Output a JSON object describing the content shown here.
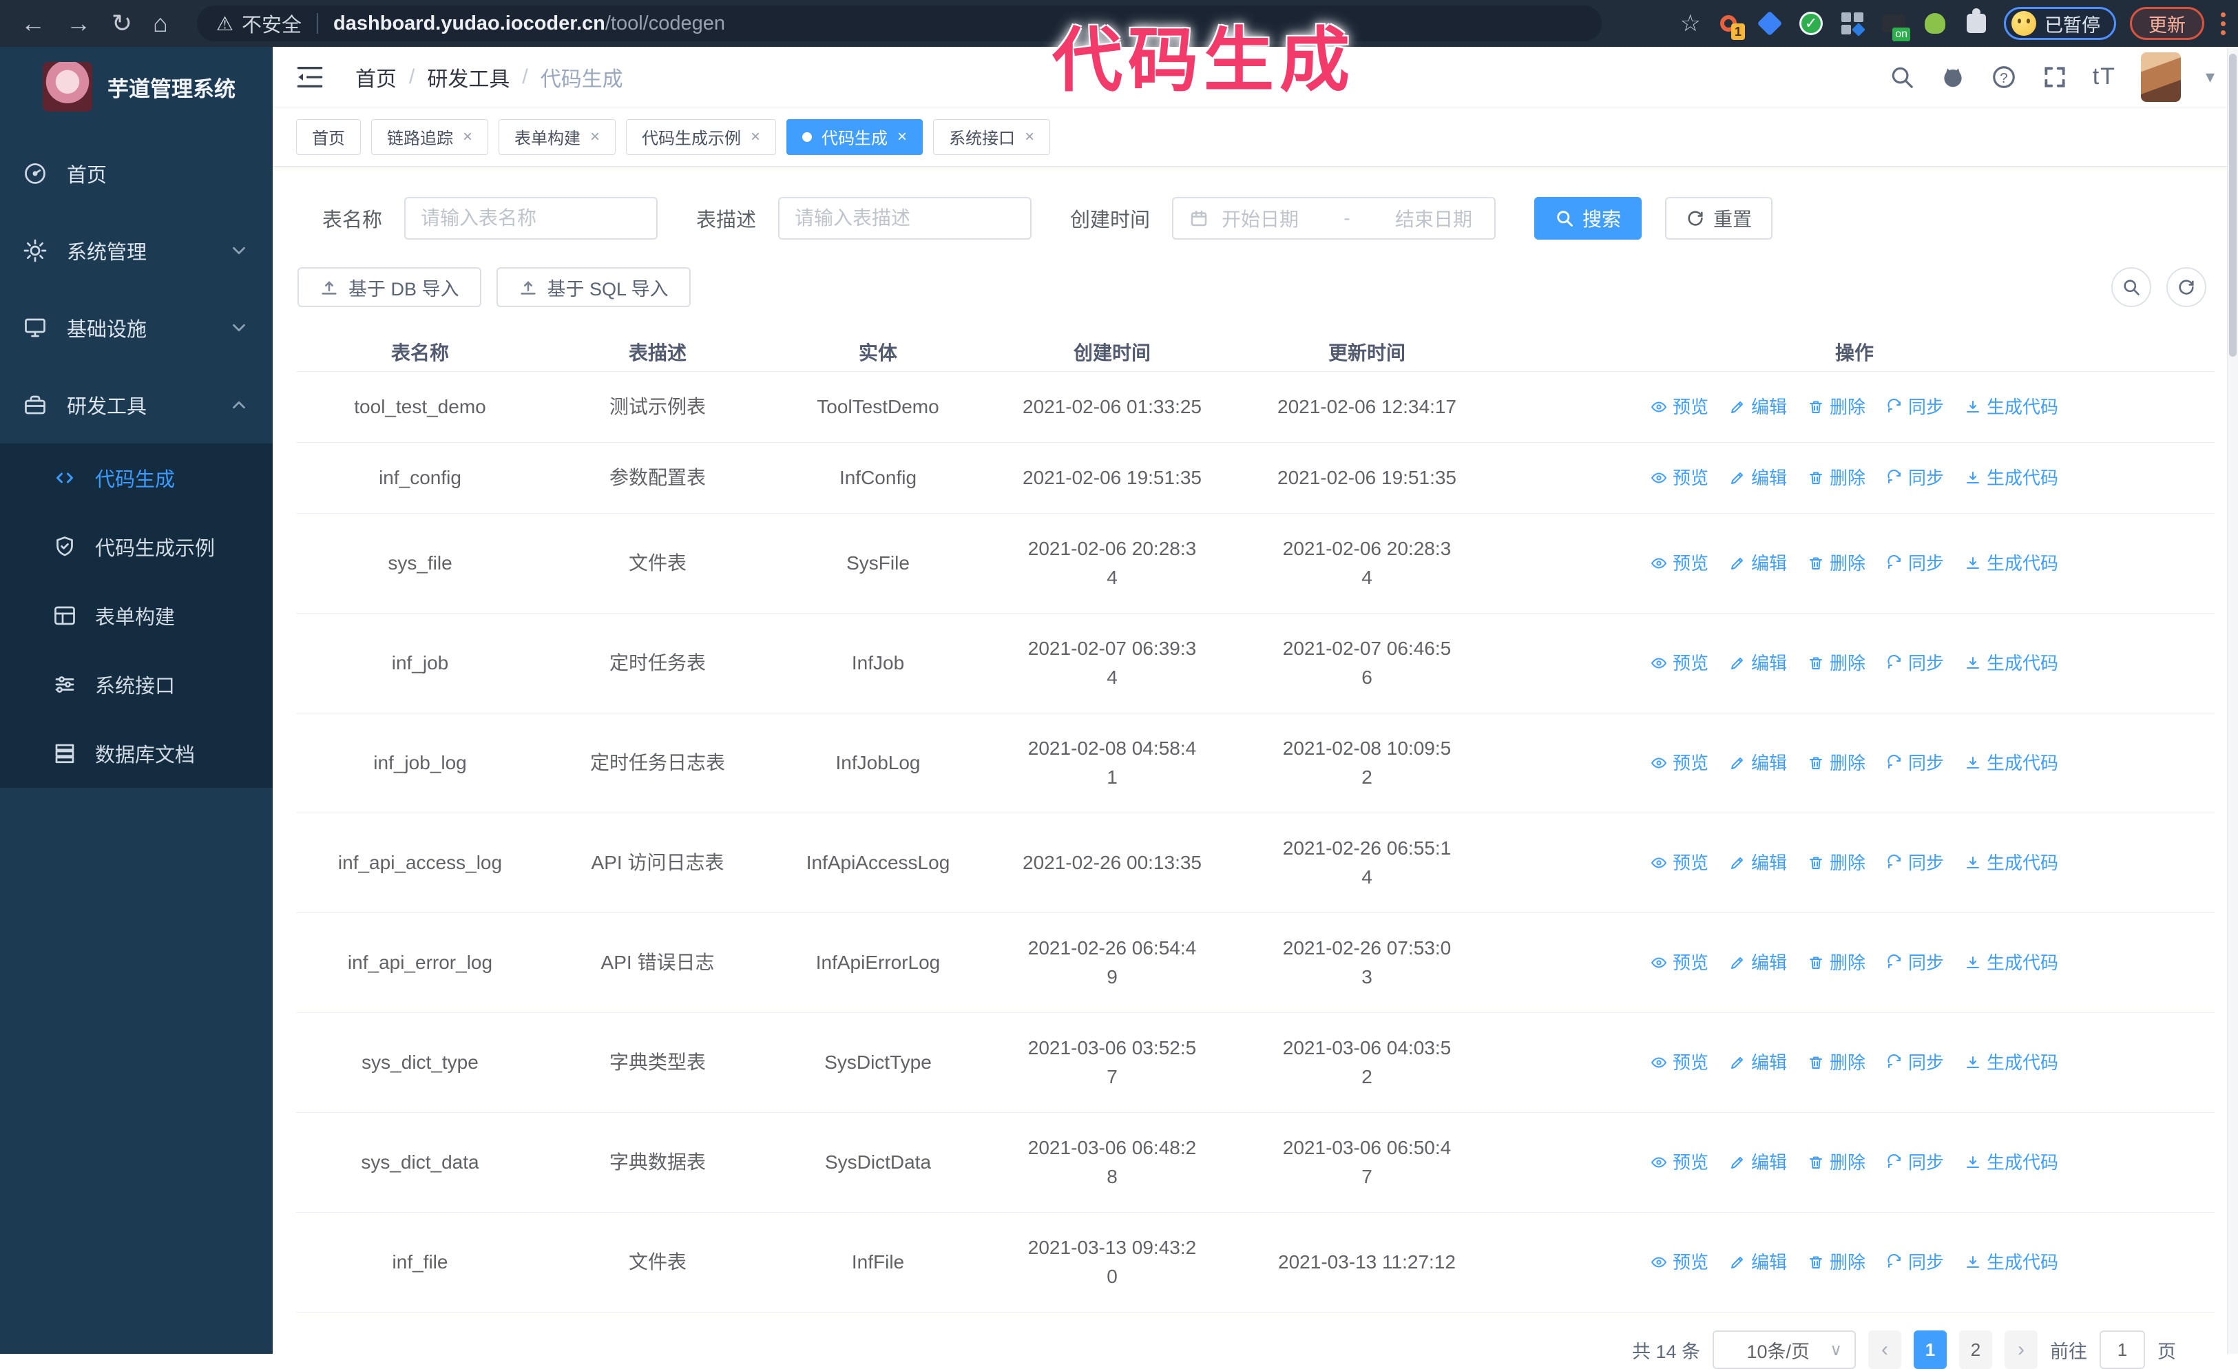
{
  "colors": {
    "accent": "#409eff",
    "annotation": "#f23a6b",
    "sidebar_bg": "#1d3a53",
    "submenu_bg": "#142c3f"
  },
  "annotation": {
    "text": "代码生成"
  },
  "browser": {
    "security_label": "不安全",
    "url_host": "dashboard.yudao.iocoder.cn",
    "url_path": "/tool/codegen",
    "ext_badge_1": "1",
    "ext_badge_on": "on",
    "paused_label": "已暂停",
    "update_label": "更新"
  },
  "sidebar": {
    "app_title": "芋道管理系统",
    "menu": [
      {
        "label": "首页",
        "icon": "dashboard",
        "chevron": null
      },
      {
        "label": "系统管理",
        "icon": "gear",
        "chevron": "down"
      },
      {
        "label": "基础设施",
        "icon": "monitor",
        "chevron": "down"
      },
      {
        "label": "研发工具",
        "icon": "toolbox",
        "chevron": "up"
      }
    ],
    "submenu": [
      {
        "label": "代码生成",
        "icon": "code",
        "active": true
      },
      {
        "label": "代码生成示例",
        "icon": "shield",
        "active": false
      },
      {
        "label": "表单构建",
        "icon": "form",
        "active": false
      },
      {
        "label": "系统接口",
        "icon": "sliders",
        "active": false
      },
      {
        "label": "数据库文档",
        "icon": "rows",
        "active": false
      }
    ]
  },
  "header": {
    "breadcrumb": [
      "首页",
      "研发工具",
      "代码生成"
    ],
    "separator": "/",
    "text_size_label": "tT"
  },
  "tabs": [
    {
      "label": "首页",
      "active": false,
      "closable": false
    },
    {
      "label": "链路追踪",
      "active": false,
      "closable": true
    },
    {
      "label": "表单构建",
      "active": false,
      "closable": true
    },
    {
      "label": "代码生成示例",
      "active": false,
      "closable": true
    },
    {
      "label": "代码生成",
      "active": true,
      "closable": true
    },
    {
      "label": "系统接口",
      "active": false,
      "closable": true
    }
  ],
  "search": {
    "table_name_label": "表名称",
    "table_name_placeholder": "请输入表名称",
    "table_desc_label": "表描述",
    "table_desc_placeholder": "请输入表描述",
    "create_time_label": "创建时间",
    "start_date_placeholder": "开始日期",
    "range_separator": "-",
    "end_date_placeholder": "结束日期",
    "search_label": "搜索",
    "reset_label": "重置"
  },
  "toolbar": {
    "import_db_label": "基于 DB 导入",
    "import_sql_label": "基于 SQL 导入"
  },
  "table": {
    "columns": [
      "表名称",
      "表描述",
      "实体",
      "创建时间",
      "更新时间",
      "操作"
    ],
    "actions": [
      "预览",
      "编辑",
      "删除",
      "同步",
      "生成代码"
    ],
    "rows": [
      {
        "name": "tool_test_demo",
        "desc": "测试示例表",
        "entity": "ToolTestDemo",
        "created": "2021-02-06 01:33:25",
        "updated": "2021-02-06 12:34:17"
      },
      {
        "name": "inf_config",
        "desc": "参数配置表",
        "entity": "InfConfig",
        "created": "2021-02-06 19:51:35",
        "updated": "2021-02-06 19:51:35"
      },
      {
        "name": "sys_file",
        "desc": "文件表",
        "entity": "SysFile",
        "created": "2021-02-06 20:28:3\n4",
        "updated": "2021-02-06 20:28:3\n4"
      },
      {
        "name": "inf_job",
        "desc": "定时任务表",
        "entity": "InfJob",
        "created": "2021-02-07 06:39:3\n4",
        "updated": "2021-02-07 06:46:5\n6"
      },
      {
        "name": "inf_job_log",
        "desc": "定时任务日志表",
        "entity": "InfJobLog",
        "created": "2021-02-08 04:58:4\n1",
        "updated": "2021-02-08 10:09:5\n2"
      },
      {
        "name": "inf_api_access_log",
        "desc": "API 访问日志表",
        "entity": "InfApiAccessLog",
        "created": "2021-02-26 00:13:35",
        "updated": "2021-02-26 06:55:1\n4"
      },
      {
        "name": "inf_api_error_log",
        "desc": "API 错误日志",
        "entity": "InfApiErrorLog",
        "created": "2021-02-26 06:54:4\n9",
        "updated": "2021-02-26 07:53:0\n3"
      },
      {
        "name": "sys_dict_type",
        "desc": "字典类型表",
        "entity": "SysDictType",
        "created": "2021-03-06 03:52:5\n7",
        "updated": "2021-03-06 04:03:5\n2"
      },
      {
        "name": "sys_dict_data",
        "desc": "字典数据表",
        "entity": "SysDictData",
        "created": "2021-03-06 06:48:2\n8",
        "updated": "2021-03-06 06:50:4\n7"
      },
      {
        "name": "inf_file",
        "desc": "文件表",
        "entity": "InfFile",
        "created": "2021-03-13 09:43:2\n0",
        "updated": "2021-03-13 11:27:12"
      }
    ]
  },
  "pagination": {
    "total": "共 14 条",
    "page_size": "10条/页",
    "pages": [
      "1",
      "2"
    ],
    "active_page": "1",
    "goto_label": "前往",
    "goto_value": "1",
    "goto_unit": "页"
  }
}
